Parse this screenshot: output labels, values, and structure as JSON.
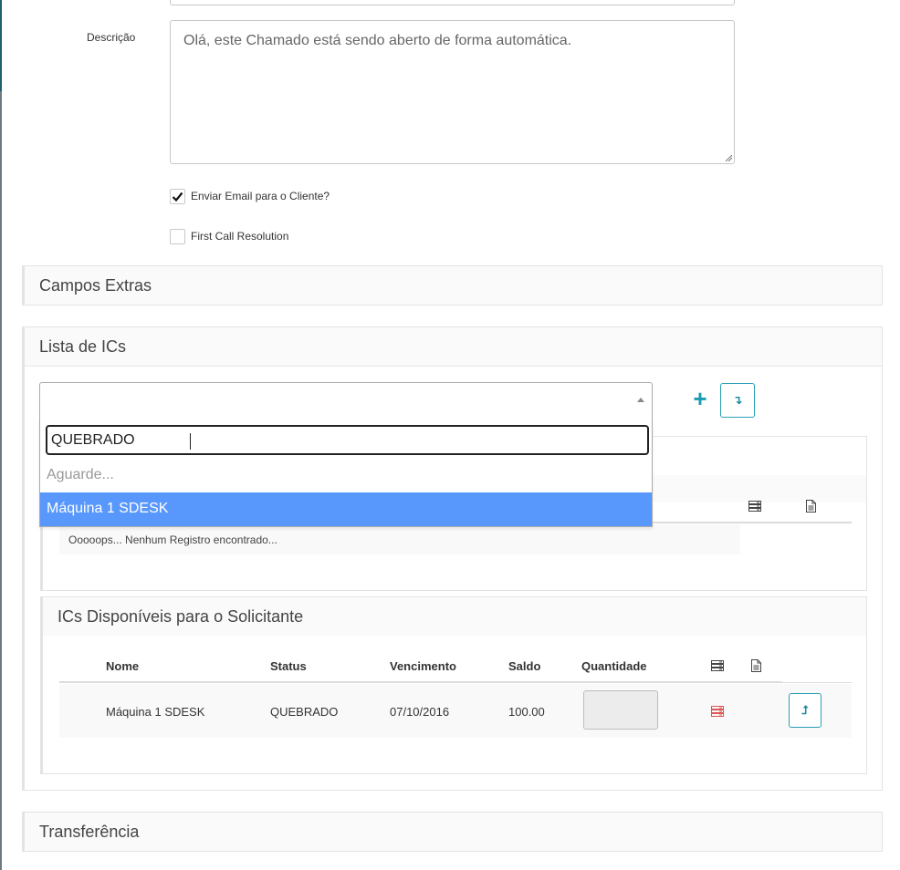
{
  "form": {
    "description_label": "Descrição",
    "description_value": "Olá, este Chamado está sendo aberto de forma automática.",
    "send_email_label": "Enviar Email para o Cliente?",
    "send_email_checked": true,
    "fcr_label": "First Call Resolution",
    "fcr_checked": false
  },
  "panels": {
    "extras_title": "Campos Extras",
    "ics_title": "Lista de ICs",
    "transfer_title": "Transferência"
  },
  "ic_select": {
    "search_value": "QUEBRADO",
    "loading_text": "Aguarde...",
    "options": [
      "Máquina 1 SDESK"
    ],
    "highlighted_option": "Máquina 1 SDESK"
  },
  "selected_ics": {
    "empty_message": "Ooooops... Nenhum Registro encontrado..."
  },
  "available_ics": {
    "title": "ICs Disponíveis para o Solicitante",
    "columns": [
      "Nome",
      "Status",
      "Vencimento",
      "Saldo",
      "Quantidade"
    ],
    "rows": [
      {
        "nome": "Máquina 1 SDESK",
        "status": "QUEBRADO",
        "vencimento": "07/10/2016",
        "saldo": "100.00",
        "quantidade": ""
      }
    ]
  },
  "colors": {
    "accent": "#1a9bb3",
    "highlight": "#5897fb",
    "server_alert": "#e05555"
  }
}
